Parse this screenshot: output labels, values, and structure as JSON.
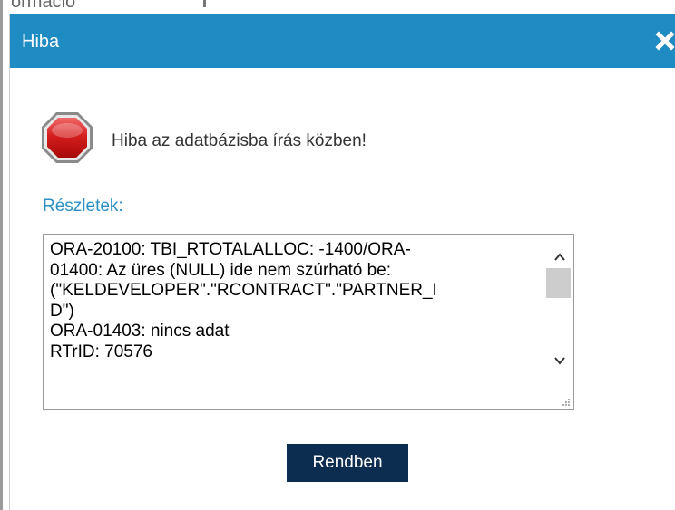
{
  "background": {
    "partial_text": "ormáció"
  },
  "dialog": {
    "title": "Hiba",
    "close_icon": "close-icon",
    "status_icon": "stop-icon",
    "message": "Hiba az adatbázisba írás közben!",
    "details_label": "Részletek:",
    "details_lines": [
      "ORA-20100: TBI_RTOTALALLOC: -1400/ORA-",
      "01400: Az üres (NULL) ide nem szúrható be:",
      "(\"KELDEVELOPER\".\"RCONTRACT\".\"PARTNER_I",
      "D\")",
      "ORA-01403: nincs adat",
      "RTrID: 70576"
    ],
    "ok_label": "Rendben"
  },
  "colors": {
    "titlebar": "#1f8bc3",
    "details_label": "#2b8fc4",
    "ok_button": "#0c2d4f",
    "stop_icon": "#cc1111"
  }
}
